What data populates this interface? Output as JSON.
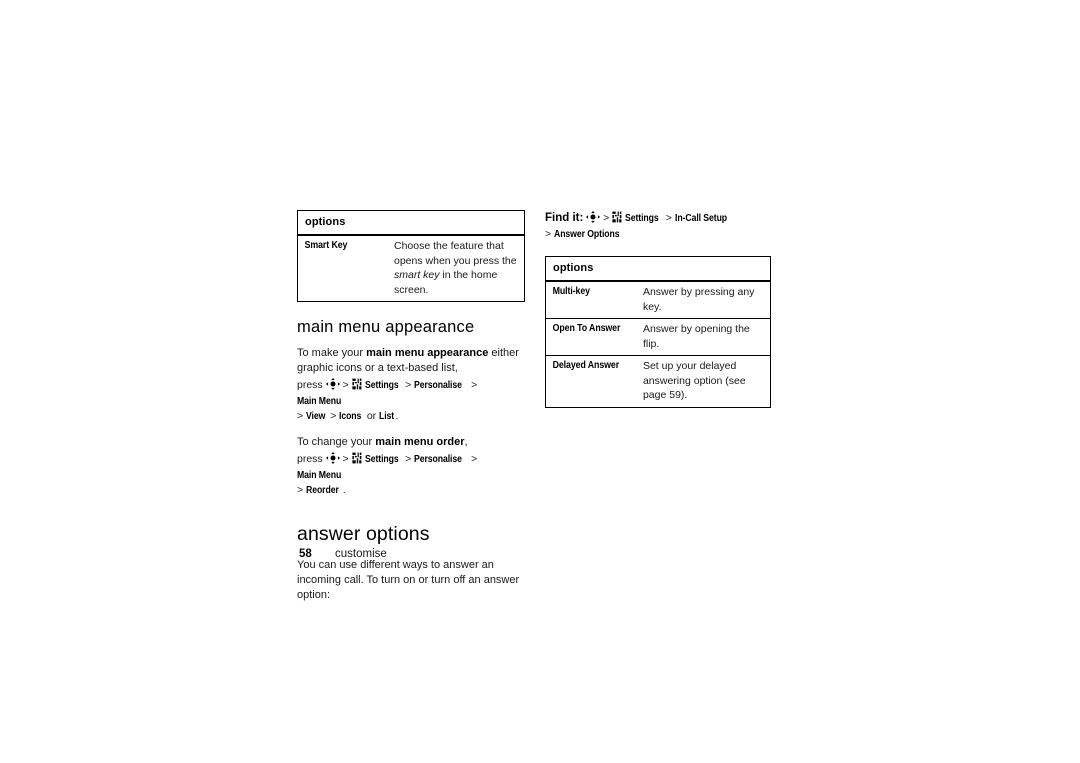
{
  "page": {
    "number": "58",
    "section_label": "customise"
  },
  "left_column": {
    "smart_key_table": {
      "header": "options",
      "rows": [
        {
          "key": "Smart Key",
          "desc_before": "Choose the feature that opens when you press the ",
          "desc_italic": "smart key",
          "desc_after": " in the home screen."
        }
      ]
    },
    "main_menu_appearance": {
      "heading": "main menu appearance",
      "para1_before": "To make your ",
      "para1_bold": "main menu appearance",
      "para1_after": " either graphic icons or a text-based list,",
      "path1": {
        "press": "press",
        "nav_icon": "navigation-key-icon",
        "settings_icon": "settings-menu-icon",
        "items": [
          "Settings",
          "Personalise",
          "Main Menu",
          "View",
          "Icons"
        ],
        "or_word": "or",
        "last_item": "List",
        "period": "."
      },
      "para2_before": "To change your ",
      "para2_bold": "main menu order",
      "para2_after": ",",
      "path2": {
        "press": "press",
        "nav_icon": "navigation-key-icon",
        "settings_icon": "settings-menu-icon",
        "items": [
          "Settings",
          "Personalise",
          "Main Menu",
          "Reorder"
        ],
        "period": "."
      }
    },
    "answer_options": {
      "heading": "answer options",
      "para": "You can use different ways to answer an incoming call. To turn on or turn off an answer option:"
    }
  },
  "right_column": {
    "find_it": {
      "label": "Find it:",
      "nav_icon": "navigation-key-icon",
      "settings_icon": "settings-menu-icon",
      "items": [
        "Settings",
        "In-Call Setup",
        "Answer Options"
      ]
    },
    "answer_options_table": {
      "header": "options",
      "rows": [
        {
          "key": "Multi-key",
          "desc": "Answer by pressing any key."
        },
        {
          "key": "Open To Answer",
          "desc": "Answer by opening the flip."
        },
        {
          "key": "Delayed Answer",
          "desc": "Set up your delayed answering option (see page 59)."
        }
      ]
    }
  },
  "colors": {
    "text": "#000000",
    "body_text": "#1a1a1a",
    "rule": "#000000",
    "background": "#ffffff"
  }
}
